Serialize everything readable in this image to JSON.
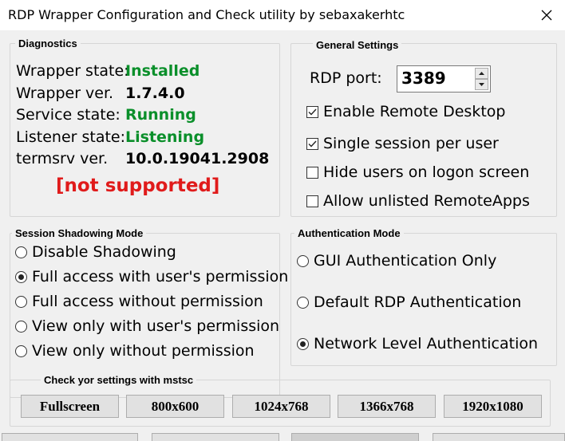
{
  "window": {
    "title": "RDP Wrapper Configuration and Check utility by sebaxakerhtc"
  },
  "diagnostics": {
    "title": "Diagnostics",
    "wrapper_state_label": "Wrapper state:",
    "wrapper_state_value": "Installed",
    "wrapper_ver_label": "Wrapper ver.",
    "wrapper_ver_value": "1.7.4.0",
    "service_state_label": "Service state:",
    "service_state_value": "Running",
    "listener_state_label": "Listener state:",
    "listener_state_value": "Listening",
    "termsrv_label": "termsrv ver.",
    "termsrv_value": "10.0.19041.2908",
    "support_status": "[not supported]"
  },
  "general": {
    "title": "General Settings",
    "rdp_port_label": "RDP port:",
    "rdp_port_value": "3389",
    "options": [
      {
        "label": "Enable Remote Desktop",
        "checked": true
      },
      {
        "label": "Single session per user",
        "checked": true
      },
      {
        "label": "Hide users on logon screen",
        "checked": false
      },
      {
        "label": "Allow unlisted RemoteApps",
        "checked": false
      }
    ]
  },
  "shadowing": {
    "title": "Session Shadowing Mode",
    "options": [
      {
        "label": "Disable Shadowing",
        "selected": false
      },
      {
        "label": "Full access with user's permission",
        "selected": true
      },
      {
        "label": "Full access without permission",
        "selected": false
      },
      {
        "label": "View only with user's permission",
        "selected": false
      },
      {
        "label": "View only without permission",
        "selected": false
      }
    ]
  },
  "auth": {
    "title": "Authentication Mode",
    "options": [
      {
        "label": "GUI Authentication Only",
        "selected": false
      },
      {
        "label": "Default RDP Authentication",
        "selected": false
      },
      {
        "label": "Network Level Authentication",
        "selected": true
      }
    ]
  },
  "mstsc": {
    "title": "Check yor settings with mstsc",
    "buttons": [
      "Fullscreen",
      "800x600",
      "1024x768",
      "1366x768",
      "1920x1080"
    ]
  },
  "colors": {
    "ok": "#0a8f2a",
    "error": "#e01b1b"
  }
}
